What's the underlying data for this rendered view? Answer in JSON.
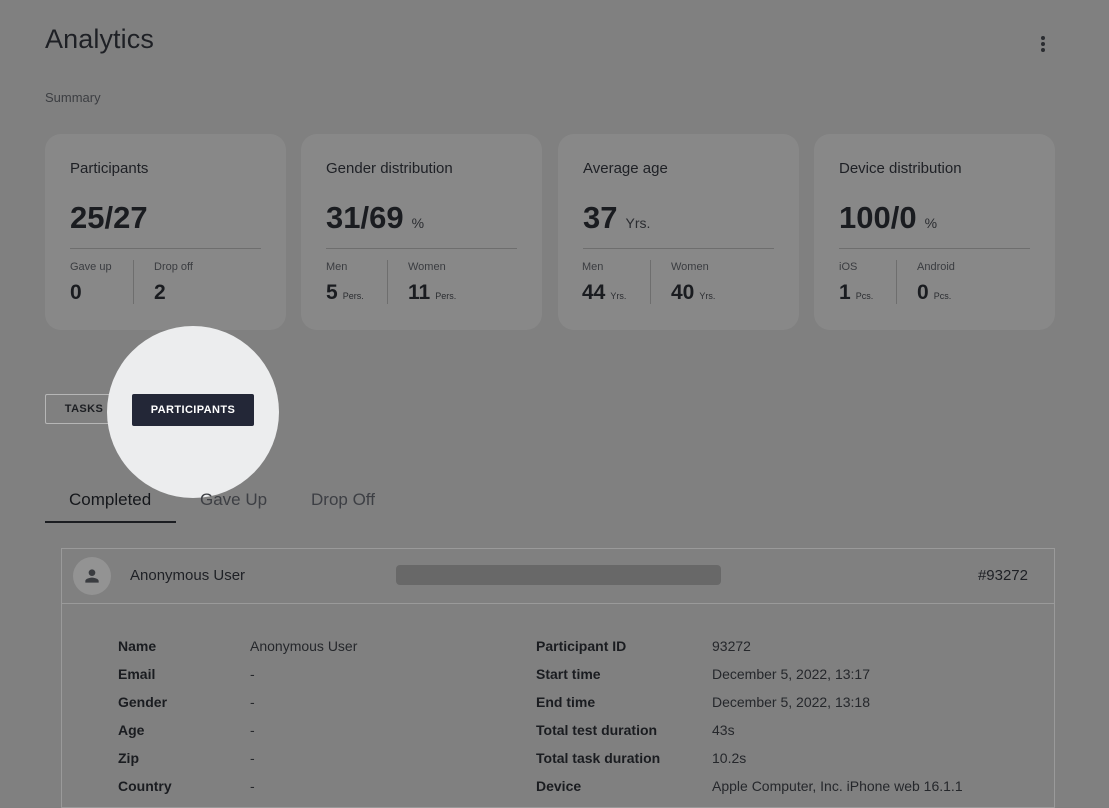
{
  "header": {
    "title": "Analytics",
    "summary_label": "Summary",
    "menu_icon": "more-vert-icon"
  },
  "cards": [
    {
      "title": "Participants",
      "big": "25/27",
      "unit": "",
      "subs": [
        {
          "label": "Gave up",
          "value": "0",
          "unit": ""
        },
        {
          "label": "Drop off",
          "value": "2",
          "unit": ""
        }
      ]
    },
    {
      "title": "Gender distribution",
      "big": "31/69",
      "unit": "%",
      "subs": [
        {
          "label": "Men",
          "value": "5",
          "unit": "Pers."
        },
        {
          "label": "Women",
          "value": "11",
          "unit": "Pers."
        }
      ]
    },
    {
      "title": "Average age",
      "big": "37",
      "unit": "Yrs.",
      "subs": [
        {
          "label": "Men",
          "value": "44",
          "unit": "Yrs."
        },
        {
          "label": "Women",
          "value": "40",
          "unit": "Yrs."
        }
      ]
    },
    {
      "title": "Device distribution",
      "big": "100/0",
      "unit": "%",
      "subs": [
        {
          "label": "iOS",
          "value": "1",
          "unit": "Pcs."
        },
        {
          "label": "Android",
          "value": "0",
          "unit": "Pcs."
        }
      ]
    }
  ],
  "toggle": {
    "tasks": "TASKS",
    "participants": "PARTICIPANTS"
  },
  "tabs": [
    "Completed",
    "Gave Up",
    "Drop Off"
  ],
  "participant": {
    "name": "Anonymous User",
    "id": "#93272",
    "left": [
      {
        "label": "Name",
        "value": "Anonymous User"
      },
      {
        "label": "Email",
        "value": "-"
      },
      {
        "label": "Gender",
        "value": "-"
      },
      {
        "label": "Age",
        "value": "-"
      },
      {
        "label": "Zip",
        "value": "-"
      },
      {
        "label": "Country",
        "value": "-"
      }
    ],
    "right": [
      {
        "label": "Participant ID",
        "value": "93272"
      },
      {
        "label": "Start time",
        "value": "December 5, 2022, 13:17"
      },
      {
        "label": "End time",
        "value": "December 5, 2022, 13:18"
      },
      {
        "label": "Total test duration",
        "value": "43s"
      },
      {
        "label": "Total task duration",
        "value": "10.2s"
      },
      {
        "label": "Device",
        "value": "Apple Computer, Inc. iPhone web 16.1.1"
      }
    ]
  }
}
